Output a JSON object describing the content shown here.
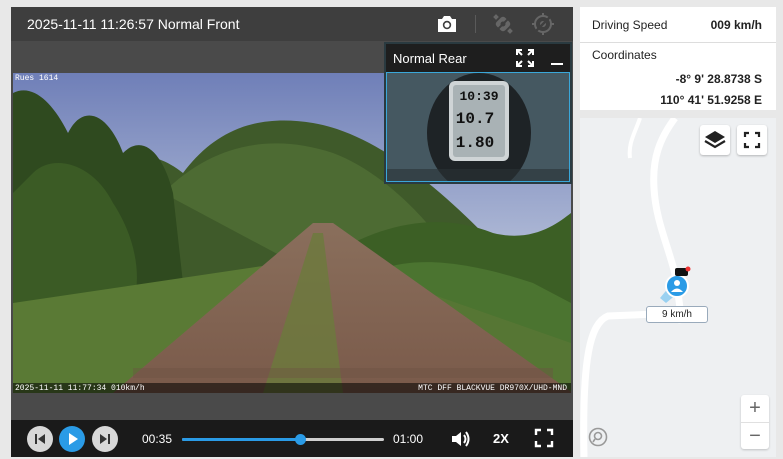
{
  "player": {
    "title": "2025-11-11 11:26:57 Normal Front",
    "overlay_top": "Rues 1614",
    "overlay_bottom_left": "2025-11-11 11:77:34 010km/h",
    "overlay_bottom_right": "MTC DFF BLACKVUE DR970X/UHD-MND",
    "pip": {
      "title": "Normal Rear",
      "gauge_time": "10:39",
      "gauge_speed": "10.7",
      "gauge_dist": "1.80"
    },
    "controls": {
      "current_time": "00:35",
      "end_time": "01:00",
      "progress": 0.585,
      "speed": "2X"
    }
  },
  "info": {
    "speed_label": "Driving Speed",
    "speed_value": "009 km/h",
    "coords_label": "Coordinates",
    "lat": "-8° 9' 28.8738 S",
    "lon": "110° 41' 51.9258 E"
  },
  "map": {
    "speed_tag": "9 km/h",
    "zoom_in": "+",
    "zoom_out": "−"
  },
  "colors": {
    "accent": "#2a9be6",
    "header_bg": "#3e3e3e",
    "controls_bg": "#1a1a1a"
  },
  "icons": [
    "camera-icon",
    "satellite-icon",
    "gps-icon",
    "expand-icon",
    "minimize-icon",
    "prev-icon",
    "play-icon",
    "next-icon",
    "volume-icon",
    "fullscreen-icon",
    "layers-icon",
    "map-fullscreen-icon",
    "location-marker-icon",
    "map-logo-icon"
  ]
}
